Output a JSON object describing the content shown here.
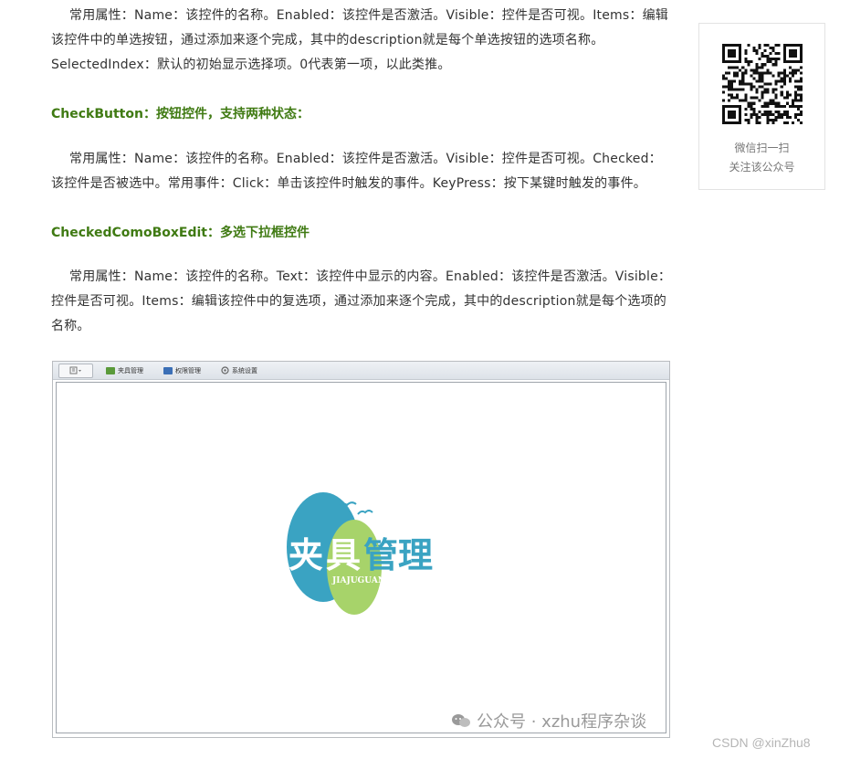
{
  "article": {
    "p1": "常用属性：Name：该控件的名称。Enabled：该控件是否激活。Visible：控件是否可视。Items：编辑该控件中的单选按钮，通过添加来逐个完成，其中的description就是每个单选按钮的选项名称。SelectedIndex：默认的初始显示选择项。0代表第一项，以此类推。",
    "h1": "CheckButton：按钮控件，支持两种状态：",
    "p2": "常用属性：Name：该控件的名称。Enabled：该控件是否激活。Visible：控件是否可视。Checked：该控件是否被选中。常用事件：Click：单击该控件时触发的事件。KeyPress：按下某键时触发的事件。",
    "h2": "CheckedComoBoxEdit：多选下拉框控件",
    "p3": "常用属性：Name：该控件的名称。Text：该控件中显示的内容。Enabled：该控件是否激活。Visible：控件是否可视。Items：编辑该控件中的复选项，通过添加来逐个完成，其中的description就是每个选项的名称。"
  },
  "app": {
    "toolbar": [
      {
        "label": "夹具管理",
        "icon": "fixture-icon"
      },
      {
        "label": "权限管理",
        "icon": "users-icon"
      },
      {
        "label": "系统设置",
        "icon": "gear-icon"
      }
    ],
    "logo_text": "夹具管理",
    "logo_sub": "JIAJUGUANLI",
    "watermark": "公众号 · xzhu程序杂谈"
  },
  "sidebar": {
    "qr_caption_line1": "微信扫一扫",
    "qr_caption_line2": "关注该公众号"
  },
  "footer": {
    "csdn_watermark": "CSDN @xinZhu8"
  },
  "colors": {
    "heading_green": "#3f7a12",
    "logo_blue": "#3aa3c2",
    "logo_green": "#a7d36a"
  }
}
